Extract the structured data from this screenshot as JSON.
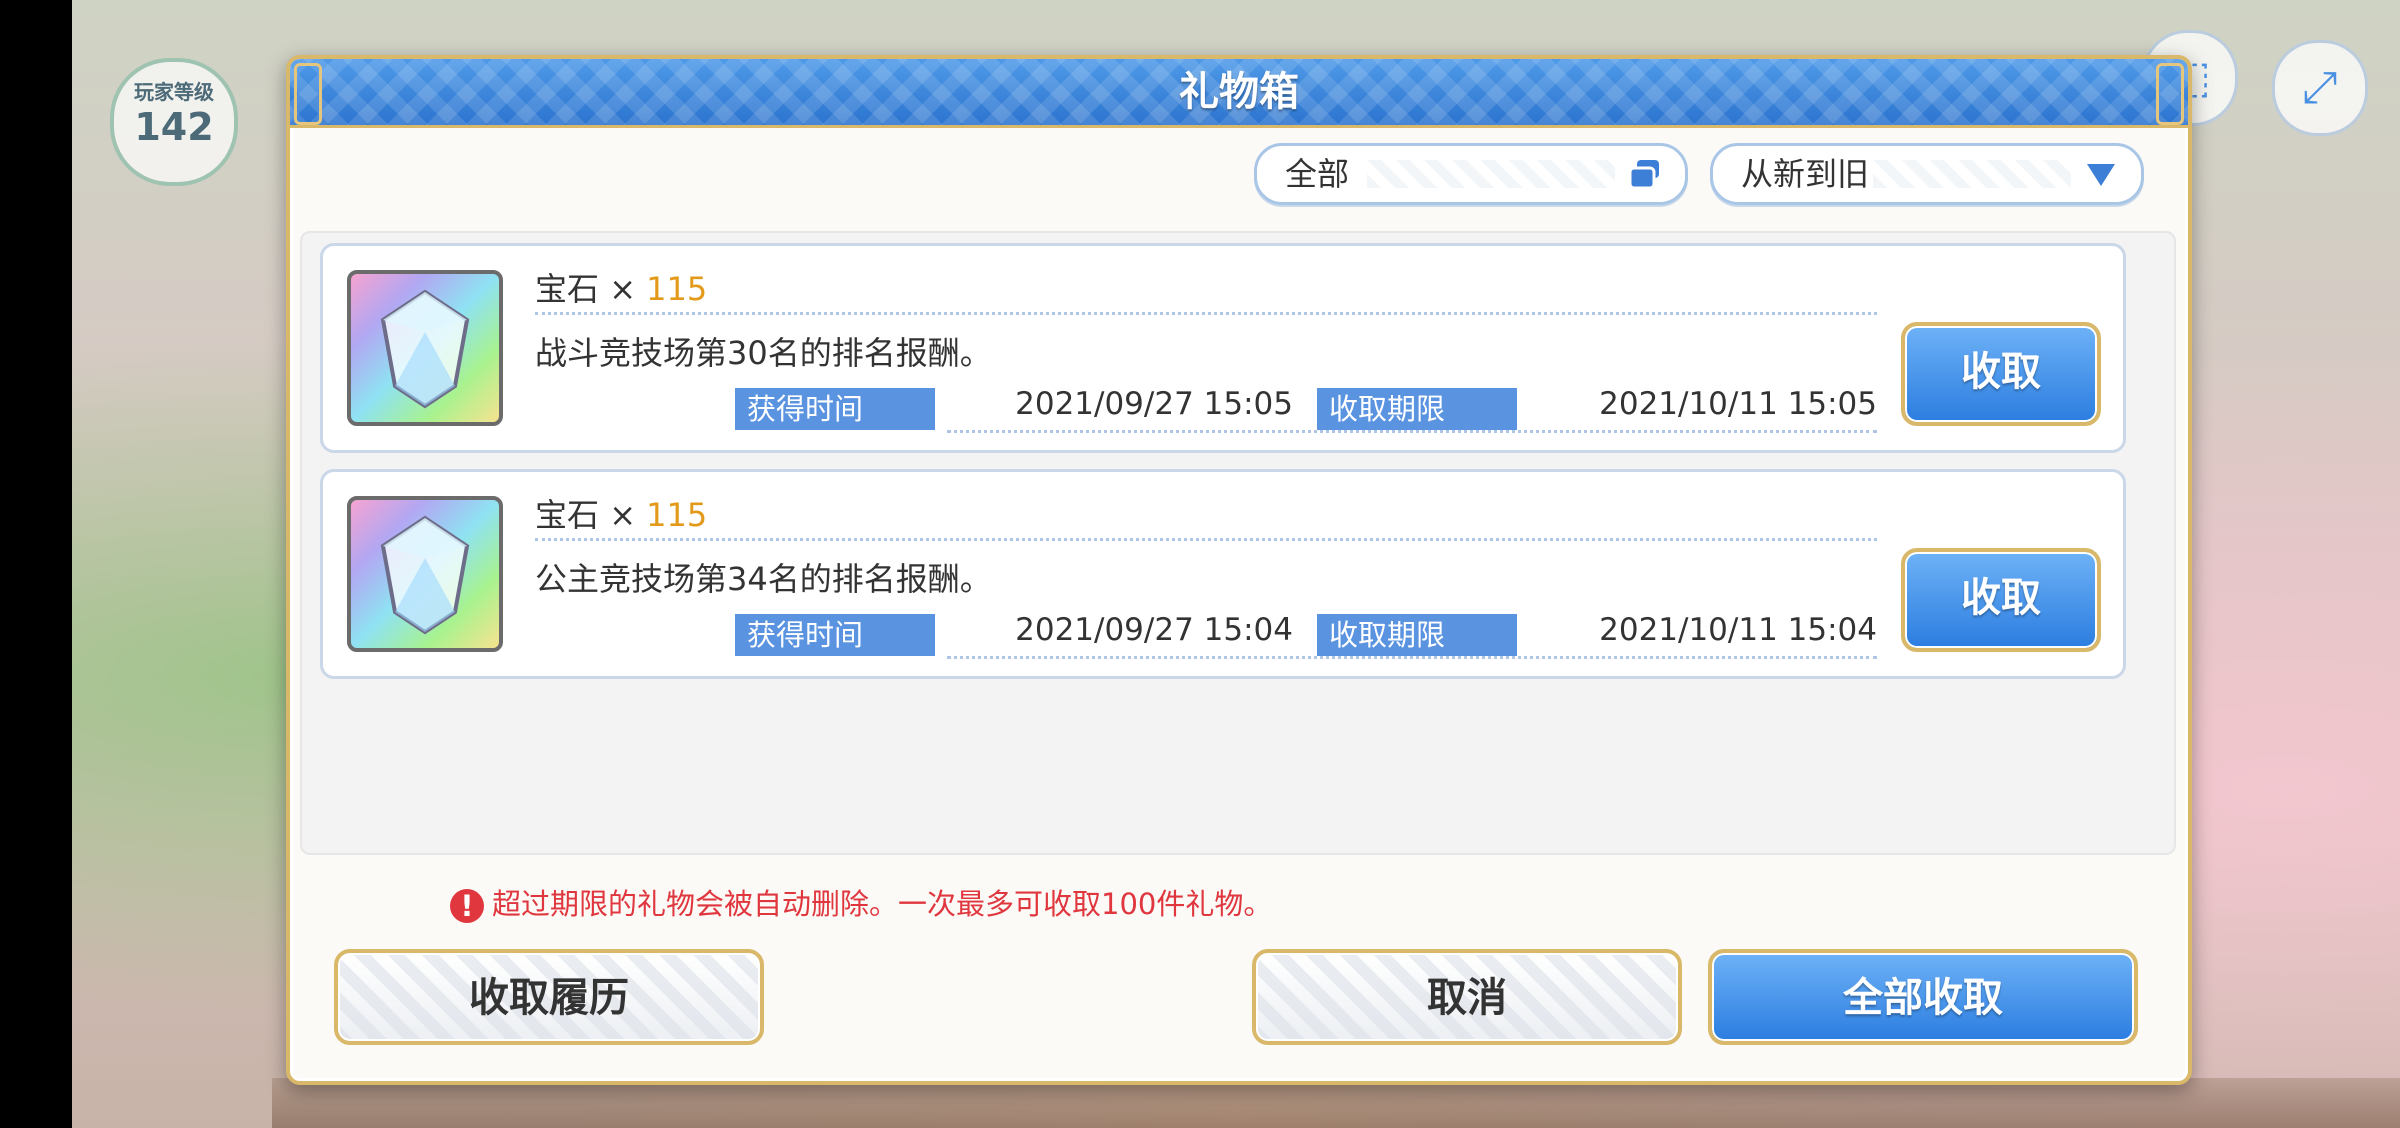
{
  "background": {
    "level_label": "玩家等级",
    "level_value": "142"
  },
  "dialog": {
    "title": "礼物箱",
    "filter": {
      "label": "全部"
    },
    "sort": {
      "label": "从新到旧"
    },
    "items": [
      {
        "item_name": "宝石",
        "times": "×",
        "quantity": "115",
        "description": "战斗竞技场第30名的排名报酬。",
        "received_label": "获得时间",
        "received_date": "2021/09/27  15:05",
        "deadline_label": "收取期限",
        "deadline_date": "2021/10/11  15:05",
        "claim_label": "收取"
      },
      {
        "item_name": "宝石",
        "times": "×",
        "quantity": "115",
        "description": "公主竞技场第34名的排名报酬。",
        "received_label": "获得时间",
        "received_date": "2021/09/27  15:04",
        "deadline_label": "收取期限",
        "deadline_date": "2021/10/11  15:04",
        "claim_label": "收取"
      }
    ],
    "warning": "超过期限的礼物会被自动删除。一次最多可收取100件礼物。",
    "history_button": "收取履历",
    "cancel_button": "取消",
    "claim_all_button": "全部收取"
  },
  "colors": {
    "title_bar": "#2c74cf",
    "accent_gold": "#d9b86a",
    "quantity": "#e39a1a",
    "warning": "#e0373f",
    "tag_blue": "#5a93e0"
  }
}
